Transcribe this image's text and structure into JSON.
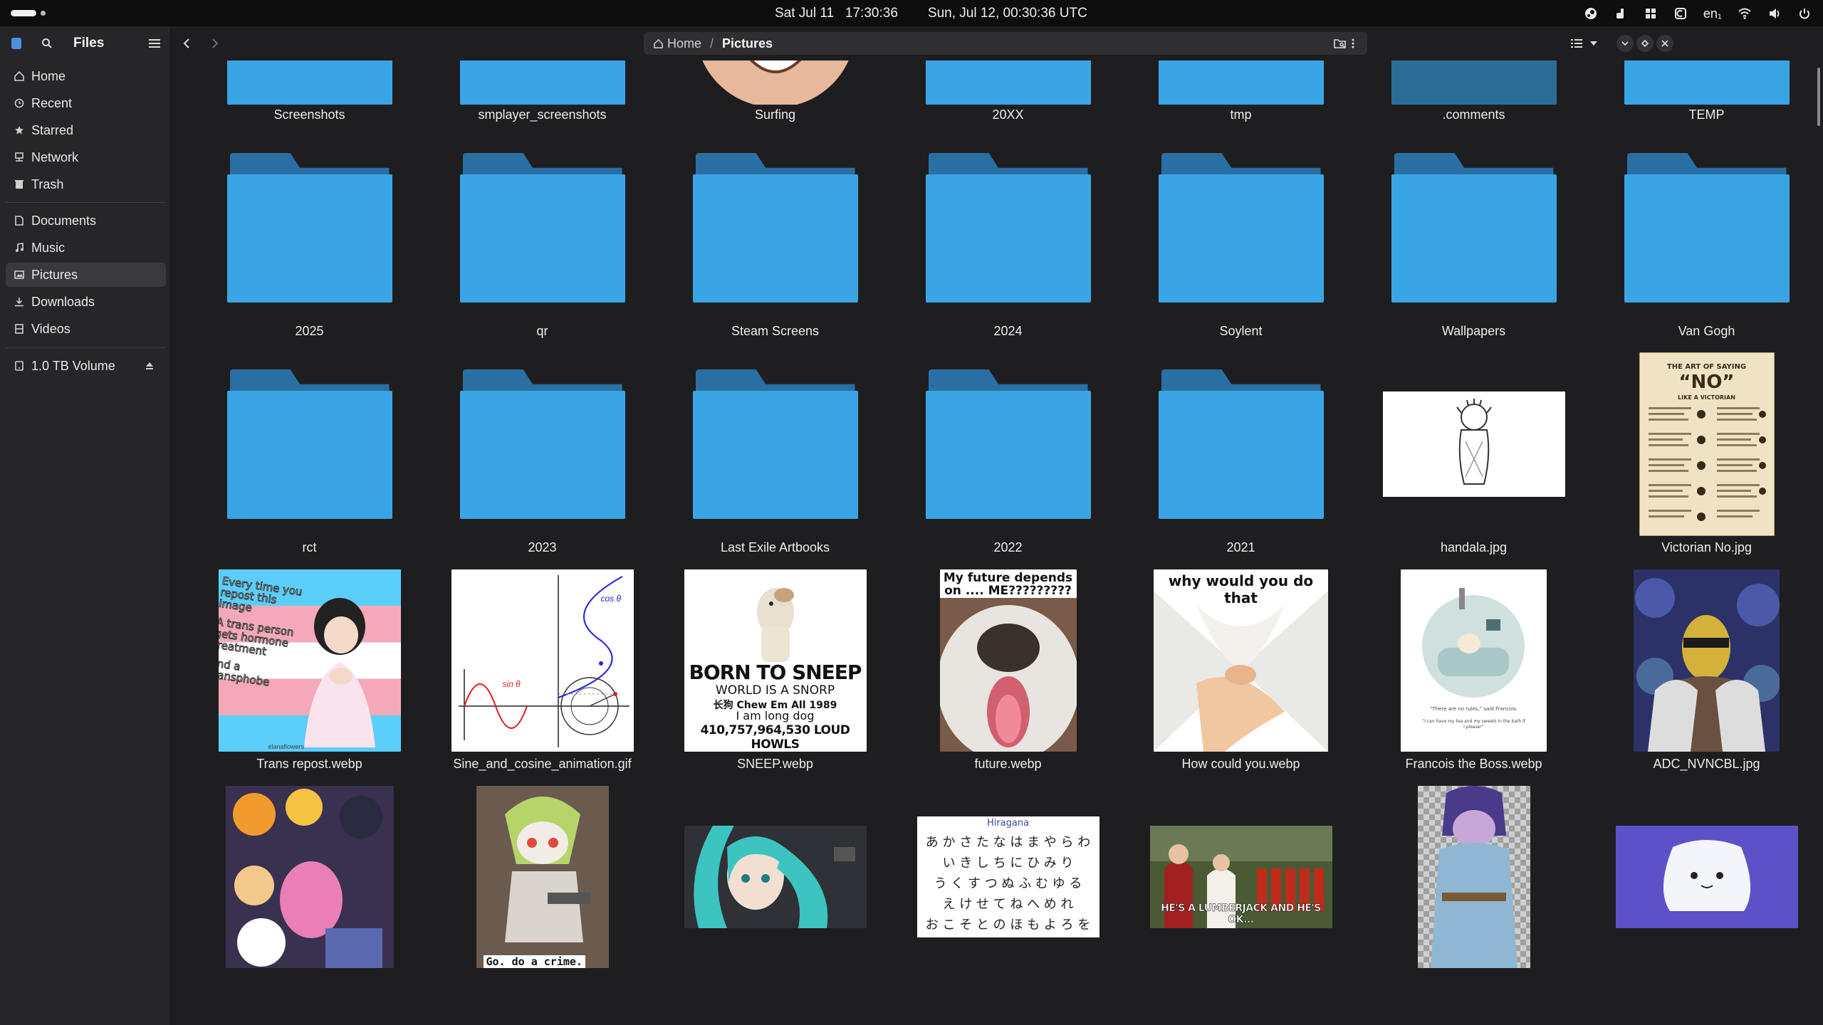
{
  "topbar": {
    "clock_local": "Sat Jul 11   17:30:36",
    "clock_utc": "Sun, Jul 12, 00:30:36 UTC",
    "keyboard_layout": "en₁"
  },
  "sidebar": {
    "title": "Files",
    "places": [
      {
        "label": "Home",
        "icon": "home-icon"
      },
      {
        "label": "Recent",
        "icon": "clock-icon"
      },
      {
        "label": "Starred",
        "icon": "star-icon"
      },
      {
        "label": "Network",
        "icon": "network-icon"
      },
      {
        "label": "Trash",
        "icon": "trash-icon"
      }
    ],
    "bookmarks": [
      {
        "label": "Documents",
        "icon": "document-icon"
      },
      {
        "label": "Music",
        "icon": "music-icon"
      },
      {
        "label": "Pictures",
        "icon": "pictures-icon",
        "active": true
      },
      {
        "label": "Downloads",
        "icon": "download-icon"
      },
      {
        "label": "Videos",
        "icon": "video-icon"
      }
    ],
    "devices": [
      {
        "label": "1.0 TB Volume",
        "icon": "drive-icon"
      }
    ]
  },
  "pathbar": {
    "home_label": "Home",
    "separator": "/",
    "current_label": "Pictures"
  },
  "files": [
    {
      "name": "Screenshots",
      "kind": "folder"
    },
    {
      "name": "smplayer_screenshots",
      "kind": "folder"
    },
    {
      "name": "Surfing",
      "kind": "image"
    },
    {
      "name": "20XX",
      "kind": "folder"
    },
    {
      "name": "tmp",
      "kind": "folder"
    },
    {
      "name": ".comments",
      "kind": "folder"
    },
    {
      "name": "TEMP",
      "kind": "folder"
    },
    {
      "name": "2025",
      "kind": "folder"
    },
    {
      "name": "qr",
      "kind": "folder"
    },
    {
      "name": "Steam Screens",
      "kind": "folder"
    },
    {
      "name": "2024",
      "kind": "folder"
    },
    {
      "name": "Soylent",
      "kind": "folder"
    },
    {
      "name": "Wallpapers",
      "kind": "folder"
    },
    {
      "name": "Van Gogh",
      "kind": "folder"
    },
    {
      "name": "rct",
      "kind": "folder"
    },
    {
      "name": "2023",
      "kind": "folder"
    },
    {
      "name": "Last Exile Artbooks",
      "kind": "folder"
    },
    {
      "name": "2022",
      "kind": "folder"
    },
    {
      "name": "2021",
      "kind": "folder"
    },
    {
      "name": "handala.jpg",
      "kind": "image"
    },
    {
      "name": "Victorian No.jpg",
      "kind": "image"
    },
    {
      "name": "Trans repost.webp",
      "kind": "image"
    },
    {
      "name": "Sine_and_cosine_animation.gif",
      "kind": "image"
    },
    {
      "name": "SNEEP.webp",
      "kind": "image"
    },
    {
      "name": "future.webp",
      "kind": "image"
    },
    {
      "name": "How could you.webp",
      "kind": "image"
    },
    {
      "name": "Francois the Boss.webp",
      "kind": "image"
    },
    {
      "name": "ADC_NVNCBL.jpg",
      "kind": "image"
    },
    {
      "name": "",
      "kind": "image"
    },
    {
      "name": "",
      "kind": "image"
    },
    {
      "name": "",
      "kind": "image"
    },
    {
      "name": "",
      "kind": "image"
    },
    {
      "name": "",
      "kind": "image"
    },
    {
      "name": "",
      "kind": "image"
    },
    {
      "name": "",
      "kind": "image"
    }
  ],
  "thumb_text": {
    "victorian_title_1": "THE ART OF SAYING",
    "victorian_title_2": "“NO”",
    "victorian_title_3": "LIKE A VICTORIAN",
    "trans_1": "Every time you",
    "trans_2": "repost this image",
    "trans_3": "A trans person",
    "trans_4": "gets hormone",
    "trans_5": "treatment",
    "trans_6": "and a",
    "trans_7": "transphobe",
    "trans_credit": "elanaflowers",
    "sine_label": "sin θ",
    "cos_label": "cos θ",
    "sneep_1": "BORN TO SNEEP",
    "sneep_2": "WORLD IS A SNORP",
    "sneep_3": "长狗 Chew Em All 1989",
    "sneep_4": "I am long dog",
    "sneep_5": "410,757,964,530 LOUD HOWLS",
    "future_1": "My future depends",
    "future_2": "on .... ME?????????",
    "howcould": "why would you do that",
    "francois_1": "“There are no rules,” said Francois.",
    "francois_2": "“I can have my tea and my sweets in the bath if I please!”",
    "crime": "Go. do a crime.",
    "hiragana_title": "Hiragana",
    "hiragana_rows": [
      "あ か さ た な は ま や ら わ",
      "い き し ち に ひ み り",
      "う く す つ ぬ ふ む ゆ る",
      "え け せ て ね へ め れ",
      "お こ そ と の ほ も よ ろ を"
    ],
    "lumberjack": "HE'S A LUMBERJACK AND HE'S OK..."
  }
}
